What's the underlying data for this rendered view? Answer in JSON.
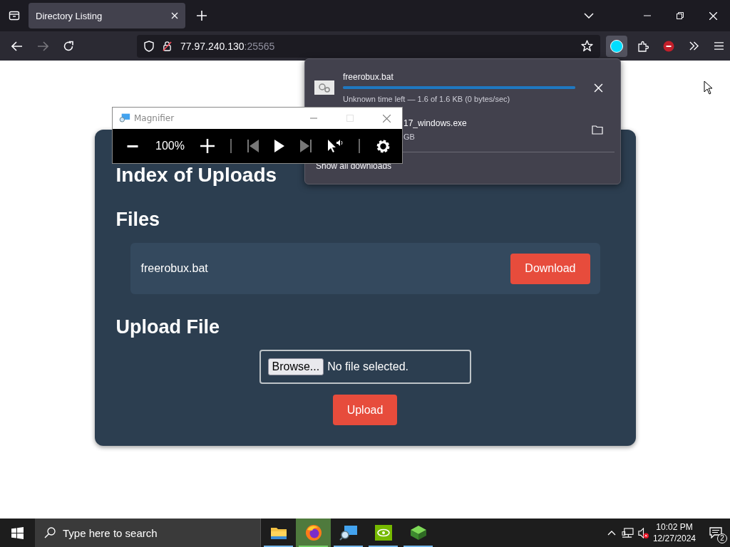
{
  "browser": {
    "tab": {
      "title": "Directory Listing",
      "selected": true
    },
    "url": {
      "host": "77.97.240.130",
      "port": ":25565"
    }
  },
  "downloads": {
    "items": [
      {
        "kind": "active",
        "name": "freerobux.bat",
        "status": "Unknown time left — 1.6 of 1.6 KB (0 bytes/sec)",
        "level": 1.0
      },
      {
        "kind": "done",
        "name": "17_windows.exe",
        "status": "GB"
      }
    ],
    "show_all": "Show all downloads"
  },
  "magnifier": {
    "title": "Magnifier",
    "zoom": "100%"
  },
  "page": {
    "title": "Index of Uploads",
    "files_heading": "Files",
    "files": [
      {
        "name": "freerobux.bat",
        "action": "Download"
      }
    ],
    "upload_heading": "Upload File",
    "browse": "Browse...",
    "file_status": "No file selected.",
    "upload_button": "Upload"
  },
  "taskbar": {
    "search_placeholder": "Type here to search",
    "apps": [
      {
        "kind": "folder",
        "selected": false
      },
      {
        "kind": "browser",
        "selected": true
      },
      {
        "kind": "magnifier",
        "selected": false
      },
      {
        "kind": "gpu",
        "selected": false
      },
      {
        "kind": "cube",
        "selected": false
      }
    ],
    "time": "10:02 PM",
    "date": "12/27/2024",
    "notifications": "2"
  }
}
